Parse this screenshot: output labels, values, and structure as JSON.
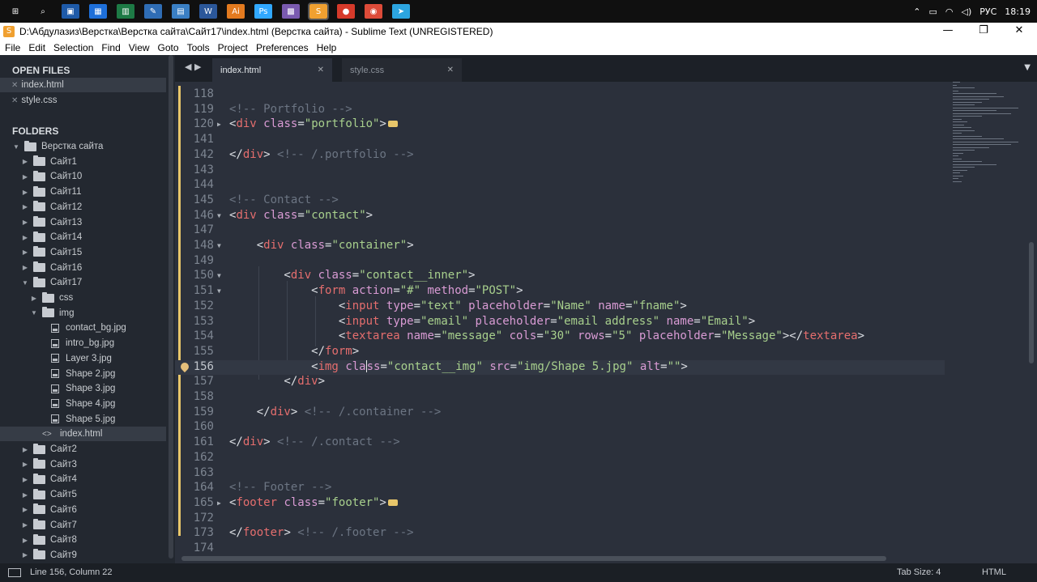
{
  "taskbar": {
    "icons": [
      {
        "name": "windows-start-icon",
        "label": "⊞"
      },
      {
        "name": "search-icon",
        "label": "⌕"
      },
      {
        "name": "app-save-icon",
        "label": "▣"
      },
      {
        "name": "app-store-icon",
        "label": "▦"
      },
      {
        "name": "app-excel-icon",
        "label": "▥"
      },
      {
        "name": "app-notes-icon",
        "label": "✎"
      },
      {
        "name": "app-chart-icon",
        "label": "▤"
      },
      {
        "name": "app-word-icon",
        "label": "W"
      },
      {
        "name": "app-illustrator-icon",
        "label": "Ai"
      },
      {
        "name": "app-photoshop-icon",
        "label": "Ps"
      },
      {
        "name": "app-media-icon",
        "label": "▩"
      },
      {
        "name": "app-sublime-icon",
        "label": "S"
      },
      {
        "name": "app-flag-icon",
        "label": "●"
      },
      {
        "name": "app-chrome-icon",
        "label": "◉"
      },
      {
        "name": "app-telegram-icon",
        "label": "➤"
      }
    ],
    "tray": {
      "chevron": "⌃",
      "lang": "РУС",
      "time": "18:19"
    }
  },
  "window": {
    "title": "D:\\Абдулазиз\\Верстка\\Верстка сайта\\Сайт17\\index.html (Верстка сайта) - Sublime Text (UNREGISTERED)",
    "minimize": "—",
    "maximize": "❐",
    "close": "✕"
  },
  "menu": [
    "File",
    "Edit",
    "Selection",
    "Find",
    "View",
    "Goto",
    "Tools",
    "Project",
    "Preferences",
    "Help"
  ],
  "sidebar": {
    "open_files_heading": "OPEN FILES",
    "open_files": [
      "index.html",
      "style.css"
    ],
    "folders_heading": "FOLDERS",
    "tree": [
      {
        "label": "Верстка сайта",
        "type": "folder",
        "open": true,
        "depth": 0
      },
      {
        "label": "Сайт1",
        "type": "folder",
        "open": false,
        "depth": 1
      },
      {
        "label": "Сайт10",
        "type": "folder",
        "open": false,
        "depth": 1
      },
      {
        "label": "Сайт11",
        "type": "folder",
        "open": false,
        "depth": 1
      },
      {
        "label": "Сайт12",
        "type": "folder",
        "open": false,
        "depth": 1
      },
      {
        "label": "Сайт13",
        "type": "folder",
        "open": false,
        "depth": 1
      },
      {
        "label": "Сайт14",
        "type": "folder",
        "open": false,
        "depth": 1
      },
      {
        "label": "Сайт15",
        "type": "folder",
        "open": false,
        "depth": 1
      },
      {
        "label": "Сайт16",
        "type": "folder",
        "open": false,
        "depth": 1
      },
      {
        "label": "Сайт17",
        "type": "folder",
        "open": true,
        "depth": 1
      },
      {
        "label": "css",
        "type": "folder",
        "open": false,
        "depth": 2
      },
      {
        "label": "img",
        "type": "folder",
        "open": true,
        "depth": 2
      },
      {
        "label": "contact_bg.jpg",
        "type": "file",
        "depth": 3
      },
      {
        "label": "intro_bg.jpg",
        "type": "file",
        "depth": 3
      },
      {
        "label": "Layer 3.jpg",
        "type": "file",
        "depth": 3
      },
      {
        "label": "Shape 2.jpg",
        "type": "file",
        "depth": 3
      },
      {
        "label": "Shape 3.jpg",
        "type": "file",
        "depth": 3
      },
      {
        "label": "Shape 4.jpg",
        "type": "file",
        "depth": 3
      },
      {
        "label": "Shape 5.jpg",
        "type": "file",
        "depth": 3
      },
      {
        "label": "index.html",
        "type": "code",
        "depth": 2,
        "selected": true
      },
      {
        "label": "Сайт2",
        "type": "folder",
        "open": false,
        "depth": 1
      },
      {
        "label": "Сайт3",
        "type": "folder",
        "open": false,
        "depth": 1
      },
      {
        "label": "Сайт4",
        "type": "folder",
        "open": false,
        "depth": 1
      },
      {
        "label": "Сайт5",
        "type": "folder",
        "open": false,
        "depth": 1
      },
      {
        "label": "Сайт6",
        "type": "folder",
        "open": false,
        "depth": 1
      },
      {
        "label": "Сайт7",
        "type": "folder",
        "open": false,
        "depth": 1
      },
      {
        "label": "Сайт8",
        "type": "folder",
        "open": false,
        "depth": 1
      },
      {
        "label": "Сайт9",
        "type": "folder",
        "open": false,
        "depth": 1
      }
    ]
  },
  "tabs": {
    "nav": "◀ ▶",
    "items": [
      {
        "label": "index.html",
        "close": "✕",
        "active": true
      },
      {
        "label": "style.css",
        "close": "✕",
        "active": false
      }
    ],
    "dropdown": "▼"
  },
  "code": [
    {
      "n": "118",
      "fold": "",
      "parts": []
    },
    {
      "n": "119",
      "fold": "",
      "parts": [
        [
          "c-com",
          "<!-- Portfolio -->"
        ]
      ]
    },
    {
      "n": "120",
      "fold": "▶",
      "dots": true,
      "parts": [
        [
          "c-pun",
          "<"
        ],
        [
          "c-tag",
          "div"
        ],
        [
          "c-pun",
          " "
        ],
        [
          "c-attr",
          "class"
        ],
        [
          "c-pun",
          "="
        ],
        [
          "c-str",
          "\"portfolio\""
        ],
        [
          "c-pun",
          ">"
        ]
      ]
    },
    {
      "n": "141",
      "fold": "",
      "parts": []
    },
    {
      "n": "142",
      "fold": "",
      "parts": [
        [
          "c-pun",
          "</"
        ],
        [
          "c-tag",
          "div"
        ],
        [
          "c-pun",
          "> "
        ],
        [
          "c-com",
          "<!-- /.portfolio -->"
        ]
      ]
    },
    {
      "n": "143",
      "fold": "",
      "parts": []
    },
    {
      "n": "144",
      "fold": "",
      "parts": []
    },
    {
      "n": "145",
      "fold": "",
      "parts": [
        [
          "c-com",
          "<!-- Contact -->"
        ]
      ]
    },
    {
      "n": "146",
      "fold": "▼",
      "parts": [
        [
          "c-pun",
          "<"
        ],
        [
          "c-tag",
          "div"
        ],
        [
          "c-pun",
          " "
        ],
        [
          "c-attr",
          "class"
        ],
        [
          "c-pun",
          "="
        ],
        [
          "c-str",
          "\"contact\""
        ],
        [
          "c-pun",
          ">"
        ]
      ]
    },
    {
      "n": "147",
      "fold": "",
      "parts": []
    },
    {
      "n": "148",
      "fold": "▼",
      "parts": [
        [
          "c-pun",
          "    <"
        ],
        [
          "c-tag",
          "div"
        ],
        [
          "c-pun",
          " "
        ],
        [
          "c-attr",
          "class"
        ],
        [
          "c-pun",
          "="
        ],
        [
          "c-str",
          "\"container\""
        ],
        [
          "c-pun",
          ">"
        ]
      ]
    },
    {
      "n": "149",
      "fold": "",
      "parts": []
    },
    {
      "n": "150",
      "fold": "▼",
      "parts": [
        [
          "c-pun",
          "        <"
        ],
        [
          "c-tag",
          "div"
        ],
        [
          "c-pun",
          " "
        ],
        [
          "c-attr",
          "class"
        ],
        [
          "c-pun",
          "="
        ],
        [
          "c-str",
          "\"contact__inner\""
        ],
        [
          "c-pun",
          ">"
        ]
      ]
    },
    {
      "n": "151",
      "fold": "▼",
      "parts": [
        [
          "c-pun",
          "            <"
        ],
        [
          "c-tag",
          "form"
        ],
        [
          "c-pun",
          " "
        ],
        [
          "c-attr",
          "action"
        ],
        [
          "c-pun",
          "="
        ],
        [
          "c-str",
          "\"#\""
        ],
        [
          "c-pun",
          " "
        ],
        [
          "c-attr",
          "method"
        ],
        [
          "c-pun",
          "="
        ],
        [
          "c-str",
          "\"POST\""
        ],
        [
          "c-pun",
          ">"
        ]
      ]
    },
    {
      "n": "152",
      "fold": "",
      "parts": [
        [
          "c-pun",
          "                <"
        ],
        [
          "c-tag",
          "input"
        ],
        [
          "c-pun",
          " "
        ],
        [
          "c-attr",
          "type"
        ],
        [
          "c-pun",
          "="
        ],
        [
          "c-str",
          "\"text\""
        ],
        [
          "c-pun",
          " "
        ],
        [
          "c-attr",
          "placeholder"
        ],
        [
          "c-pun",
          "="
        ],
        [
          "c-str",
          "\"Name\""
        ],
        [
          "c-pun",
          " "
        ],
        [
          "c-attr",
          "name"
        ],
        [
          "c-pun",
          "="
        ],
        [
          "c-str",
          "\"fname\""
        ],
        [
          "c-pun",
          ">"
        ]
      ]
    },
    {
      "n": "153",
      "fold": "",
      "parts": [
        [
          "c-pun",
          "                <"
        ],
        [
          "c-tag",
          "input"
        ],
        [
          "c-pun",
          " "
        ],
        [
          "c-attr",
          "type"
        ],
        [
          "c-pun",
          "="
        ],
        [
          "c-str",
          "\"email\""
        ],
        [
          "c-pun",
          " "
        ],
        [
          "c-attr",
          "placeholder"
        ],
        [
          "c-pun",
          "="
        ],
        [
          "c-str",
          "\"email address\""
        ],
        [
          "c-pun",
          " "
        ],
        [
          "c-attr",
          "name"
        ],
        [
          "c-pun",
          "="
        ],
        [
          "c-str",
          "\"Email\""
        ],
        [
          "c-pun",
          ">"
        ]
      ]
    },
    {
      "n": "154",
      "fold": "",
      "parts": [
        [
          "c-pun",
          "                <"
        ],
        [
          "c-tag",
          "textarea"
        ],
        [
          "c-pun",
          " "
        ],
        [
          "c-attr",
          "name"
        ],
        [
          "c-pun",
          "="
        ],
        [
          "c-str",
          "\"message\""
        ],
        [
          "c-pun",
          " "
        ],
        [
          "c-attr",
          "cols"
        ],
        [
          "c-pun",
          "="
        ],
        [
          "c-str",
          "\"30\""
        ],
        [
          "c-pun",
          " "
        ],
        [
          "c-attr",
          "rows"
        ],
        [
          "c-pun",
          "="
        ],
        [
          "c-str",
          "\"5\""
        ],
        [
          "c-pun",
          " "
        ],
        [
          "c-attr",
          "placeholder"
        ],
        [
          "c-pun",
          "="
        ],
        [
          "c-str",
          "\"Message\""
        ],
        [
          "c-pun",
          "></"
        ],
        [
          "c-tag",
          "textarea"
        ],
        [
          "c-pun",
          ">"
        ]
      ]
    },
    {
      "n": "155",
      "fold": "",
      "parts": [
        [
          "c-pun",
          "            </"
        ],
        [
          "c-tag",
          "form"
        ],
        [
          "c-pun",
          ">"
        ]
      ]
    },
    {
      "n": "156",
      "fold": "",
      "current": true,
      "bookmark": true,
      "parts": [
        [
          "c-pun",
          "            <"
        ],
        [
          "c-tag",
          "img"
        ],
        [
          "c-pun",
          " "
        ],
        [
          "c-attr",
          "cla"
        ],
        [
          "caret",
          ""
        ],
        [
          "c-attr",
          "ss"
        ],
        [
          "c-pun",
          "="
        ],
        [
          "c-str",
          "\"contact__img\""
        ],
        [
          "c-pun",
          " "
        ],
        [
          "c-attr",
          "src"
        ],
        [
          "c-pun",
          "="
        ],
        [
          "c-str",
          "\"img/Shape 5.jpg\""
        ],
        [
          "c-pun",
          " "
        ],
        [
          "c-attr",
          "alt"
        ],
        [
          "c-pun",
          "="
        ],
        [
          "c-str",
          "\"\""
        ],
        [
          "c-pun",
          ">"
        ]
      ]
    },
    {
      "n": "157",
      "fold": "",
      "parts": [
        [
          "c-pun",
          "        </"
        ],
        [
          "c-tag",
          "div"
        ],
        [
          "c-pun",
          ">"
        ]
      ]
    },
    {
      "n": "158",
      "fold": "",
      "parts": []
    },
    {
      "n": "159",
      "fold": "",
      "parts": [
        [
          "c-pun",
          "    </"
        ],
        [
          "c-tag",
          "div"
        ],
        [
          "c-pun",
          "> "
        ],
        [
          "c-com",
          "<!-- /.container -->"
        ]
      ]
    },
    {
      "n": "160",
      "fold": "",
      "parts": []
    },
    {
      "n": "161",
      "fold": "",
      "parts": [
        [
          "c-pun",
          "</"
        ],
        [
          "c-tag",
          "div"
        ],
        [
          "c-pun",
          "> "
        ],
        [
          "c-com",
          "<!-- /.contact -->"
        ]
      ]
    },
    {
      "n": "162",
      "fold": "",
      "parts": []
    },
    {
      "n": "163",
      "fold": "",
      "parts": []
    },
    {
      "n": "164",
      "fold": "",
      "parts": [
        [
          "c-com",
          "<!-- Footer -->"
        ]
      ]
    },
    {
      "n": "165",
      "fold": "▶",
      "dots": true,
      "parts": [
        [
          "c-pun",
          "<"
        ],
        [
          "c-tag",
          "footer"
        ],
        [
          "c-pun",
          " "
        ],
        [
          "c-attr",
          "class"
        ],
        [
          "c-pun",
          "="
        ],
        [
          "c-str",
          "\"footer\""
        ],
        [
          "c-pun",
          ">"
        ]
      ]
    },
    {
      "n": "172",
      "fold": "",
      "parts": []
    },
    {
      "n": "173",
      "fold": "",
      "parts": [
        [
          "c-pun",
          "</"
        ],
        [
          "c-tag",
          "footer"
        ],
        [
          "c-pun",
          "> "
        ],
        [
          "c-com",
          "<!-- /.footer -->"
        ]
      ]
    },
    {
      "n": "174",
      "fold": "",
      "parts": []
    }
  ],
  "status": {
    "position": "Line 156, Column 22",
    "tab_size": "Tab Size: 4",
    "syntax": "HTML"
  }
}
